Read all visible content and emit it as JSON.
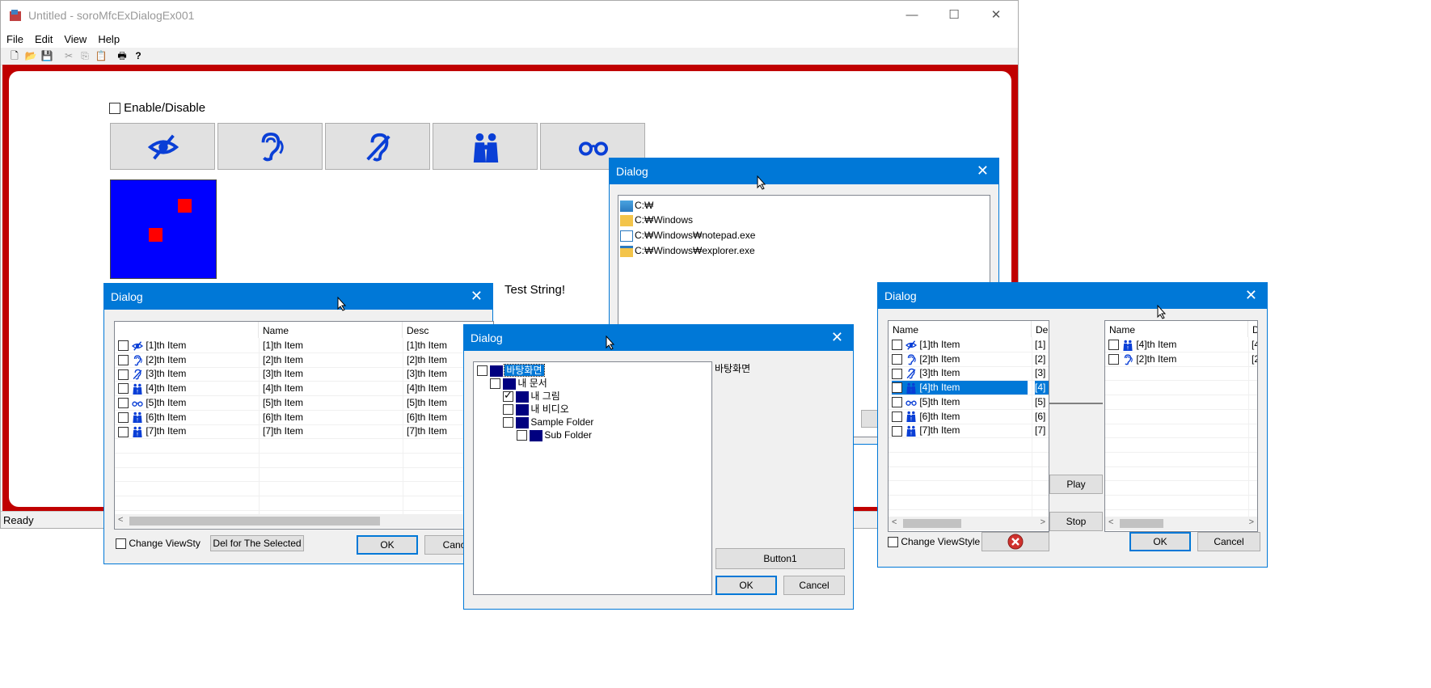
{
  "main_window": {
    "title": "Untitled - soroMfcExDialogEx001",
    "menu": [
      "File",
      "Edit",
      "View",
      "Help"
    ],
    "status": "Ready",
    "enable_checkbox_label": "Enable/Disable",
    "test_string": "Test String!",
    "icon_buttons": [
      "eye-slash-icon",
      "hearing-icon",
      "hearing-impaired-icon",
      "family-icon",
      "glasses-icon"
    ]
  },
  "dialog_list": {
    "title": "Dialog",
    "columns": [
      "",
      "Name",
      "Desc"
    ],
    "rows": [
      {
        "item": "[1]th Item",
        "name": "[1]th Item",
        "desc": "[1]th Item"
      },
      {
        "item": "[2]th Item",
        "name": "[2]th Item",
        "desc": "[2]th Item"
      },
      {
        "item": "[3]th Item",
        "name": "[3]th Item",
        "desc": "[3]th Item"
      },
      {
        "item": "[4]th Item",
        "name": "[4]th Item",
        "desc": "[4]th Item"
      },
      {
        "item": "[5]th Item",
        "name": "[5]th Item",
        "desc": "[5]th Item"
      },
      {
        "item": "[6]th Item",
        "name": "[6]th Item",
        "desc": "[6]th Item"
      },
      {
        "item": "[7]th Item",
        "name": "[7]th Item",
        "desc": "[7]th Item"
      }
    ],
    "change_viewstyle": "Change ViewSty",
    "del_selected": "Del for The Selected",
    "ok": "OK",
    "cancel": "Cance"
  },
  "dialog_files": {
    "title": "Dialog",
    "items": [
      "C:₩",
      "C:₩Windows",
      "C:₩Windows₩notepad.exe",
      "C:₩Windows₩explorer.exe"
    ]
  },
  "dialog_tree": {
    "title": "Dialog",
    "nodes": [
      {
        "label": "바탕화면",
        "checked": false
      },
      {
        "label": "내 문서",
        "checked": false
      },
      {
        "label": "내 그림",
        "checked": true
      },
      {
        "label": "내 비디오",
        "checked": false
      },
      {
        "label": "Sample Folder",
        "checked": false
      },
      {
        "label": "Sub Folder",
        "checked": false
      }
    ],
    "selected_label": "바탕화면",
    "button1": "Button1",
    "ok": "OK",
    "cancel": "Cancel"
  },
  "dialog_dual": {
    "title": "Dialog",
    "left_columns": [
      "Name",
      "De"
    ],
    "left_rows": [
      {
        "name": "[1]th Item",
        "desc": "[1]"
      },
      {
        "name": "[2]th Item",
        "desc": "[2]"
      },
      {
        "name": "[3]th Item",
        "desc": "[3]"
      },
      {
        "name": "[4]th Item",
        "desc": "[4]"
      },
      {
        "name": "[5]th Item",
        "desc": "[5]"
      },
      {
        "name": "[6]th Item",
        "desc": "[6]"
      },
      {
        "name": "[7]th Item",
        "desc": "[7]"
      }
    ],
    "right_columns": [
      "Name",
      "D"
    ],
    "right_rows": [
      {
        "name": "[4]th Item",
        "desc": "[4"
      },
      {
        "name": "[2]th Item",
        "desc": "[2"
      }
    ],
    "play": "Play",
    "stop": "Stop",
    "change_viewstyle": "Change ViewStyle",
    "ok": "OK",
    "cancel": "Cancel"
  },
  "colors": {
    "accent": "#0078d7",
    "frame": "#c00000",
    "panel_blue": "#0000ff",
    "marker": "#ff0000"
  }
}
